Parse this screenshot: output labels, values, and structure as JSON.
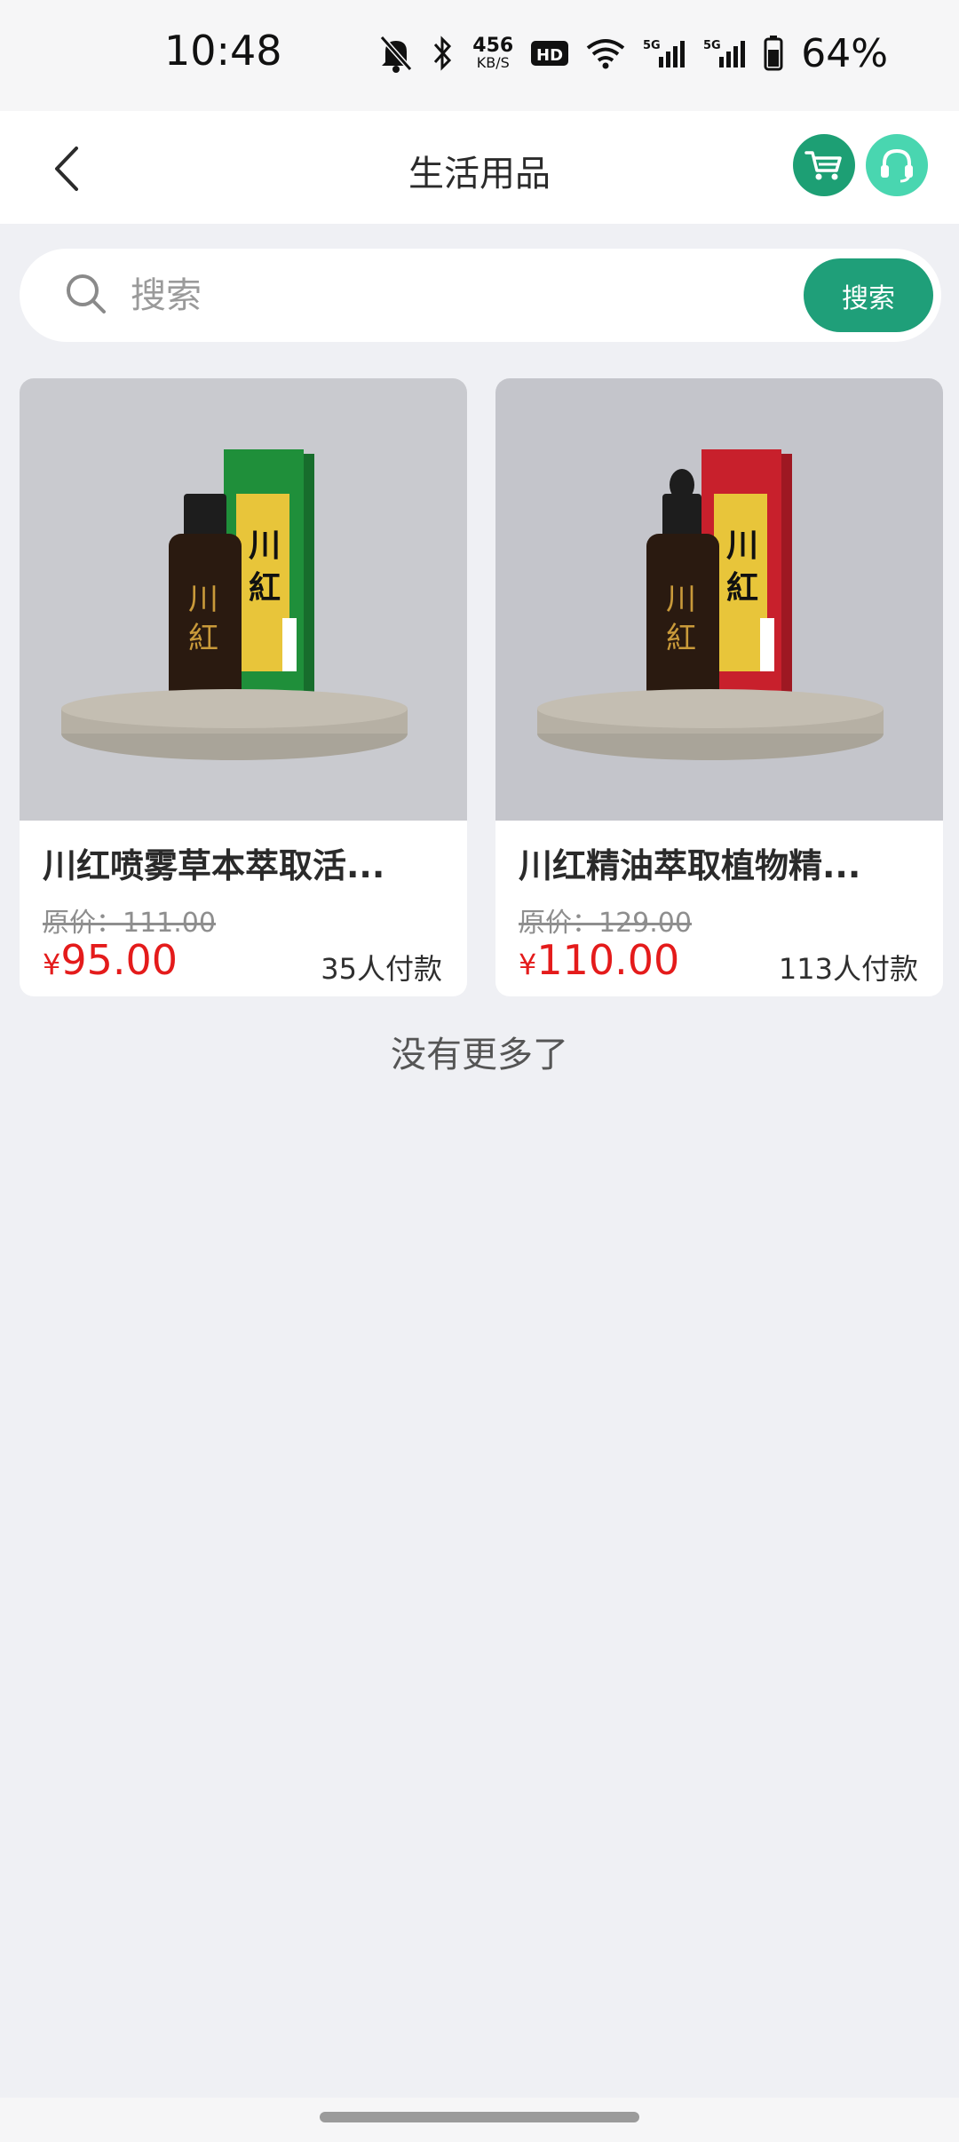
{
  "status_bar": {
    "time": "10:48",
    "net_speed_value": "456",
    "net_speed_unit": "KB/S",
    "hd_label": "HD",
    "battery": "64%",
    "icons": [
      "bell-muted-icon",
      "bluetooth-icon",
      "hd-icon",
      "wifi-icon",
      "signal-5g-icon",
      "signal-5g-icon",
      "battery-icon"
    ]
  },
  "header": {
    "title": "生活用品",
    "back_icon": "chevron-left-icon",
    "cart_icon": "cart-icon",
    "service_icon": "headset-icon",
    "colors": {
      "cart": "#1d9f74",
      "service": "#49d6b0"
    }
  },
  "search": {
    "placeholder": "搜索",
    "value": "",
    "button_label": "搜索",
    "icon": "search-icon",
    "accent_color": "#1f9f79"
  },
  "products": [
    {
      "name": "川红喷雾草本萃取活...",
      "original_price": "原价：111.00",
      "currency": "¥",
      "price": "95.00",
      "sold": "35人付款",
      "image_label": "川紅",
      "box_color": "#1f8f3a"
    },
    {
      "name": "川红精油萃取植物精...",
      "original_price": "原价：129.00",
      "currency": "¥",
      "price": "110.00",
      "sold": "113人付款",
      "image_label": "川紅",
      "box_color": "#c8202c"
    }
  ],
  "footer_text": "没有更多了",
  "price_color": "#e41b1b"
}
